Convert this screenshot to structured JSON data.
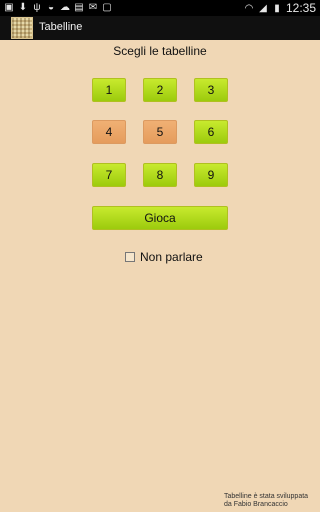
{
  "status_bar": {
    "time": "12:35",
    "left_icons": [
      "image-icon",
      "download-icon",
      "usb-icon",
      "android-icon",
      "cloud-icon",
      "shop-icon",
      "mail-icon",
      "screenshot-icon"
    ],
    "right_icons": [
      "wifi-icon",
      "signal-icon",
      "battery-icon"
    ]
  },
  "action_bar": {
    "title": "Tabelline"
  },
  "main": {
    "heading": "Scegli le tabelline",
    "numbers": [
      {
        "label": "1",
        "selected": true
      },
      {
        "label": "2",
        "selected": true
      },
      {
        "label": "3",
        "selected": true
      },
      {
        "label": "4",
        "selected": false
      },
      {
        "label": "5",
        "selected": false
      },
      {
        "label": "6",
        "selected": true
      },
      {
        "label": "7",
        "selected": true
      },
      {
        "label": "8",
        "selected": true
      },
      {
        "label": "9",
        "selected": true
      }
    ],
    "play_label": "Gioca",
    "silent_label": "Non parlare",
    "silent_checked": false
  },
  "footer": {
    "line1": "Tabelline è stata sviluppata",
    "line2": "da Fabio Brancaccio"
  },
  "colors": {
    "background": "#f0d7b5",
    "selected_button": "#b5dc1f",
    "unselected_button": "#eba46a"
  }
}
